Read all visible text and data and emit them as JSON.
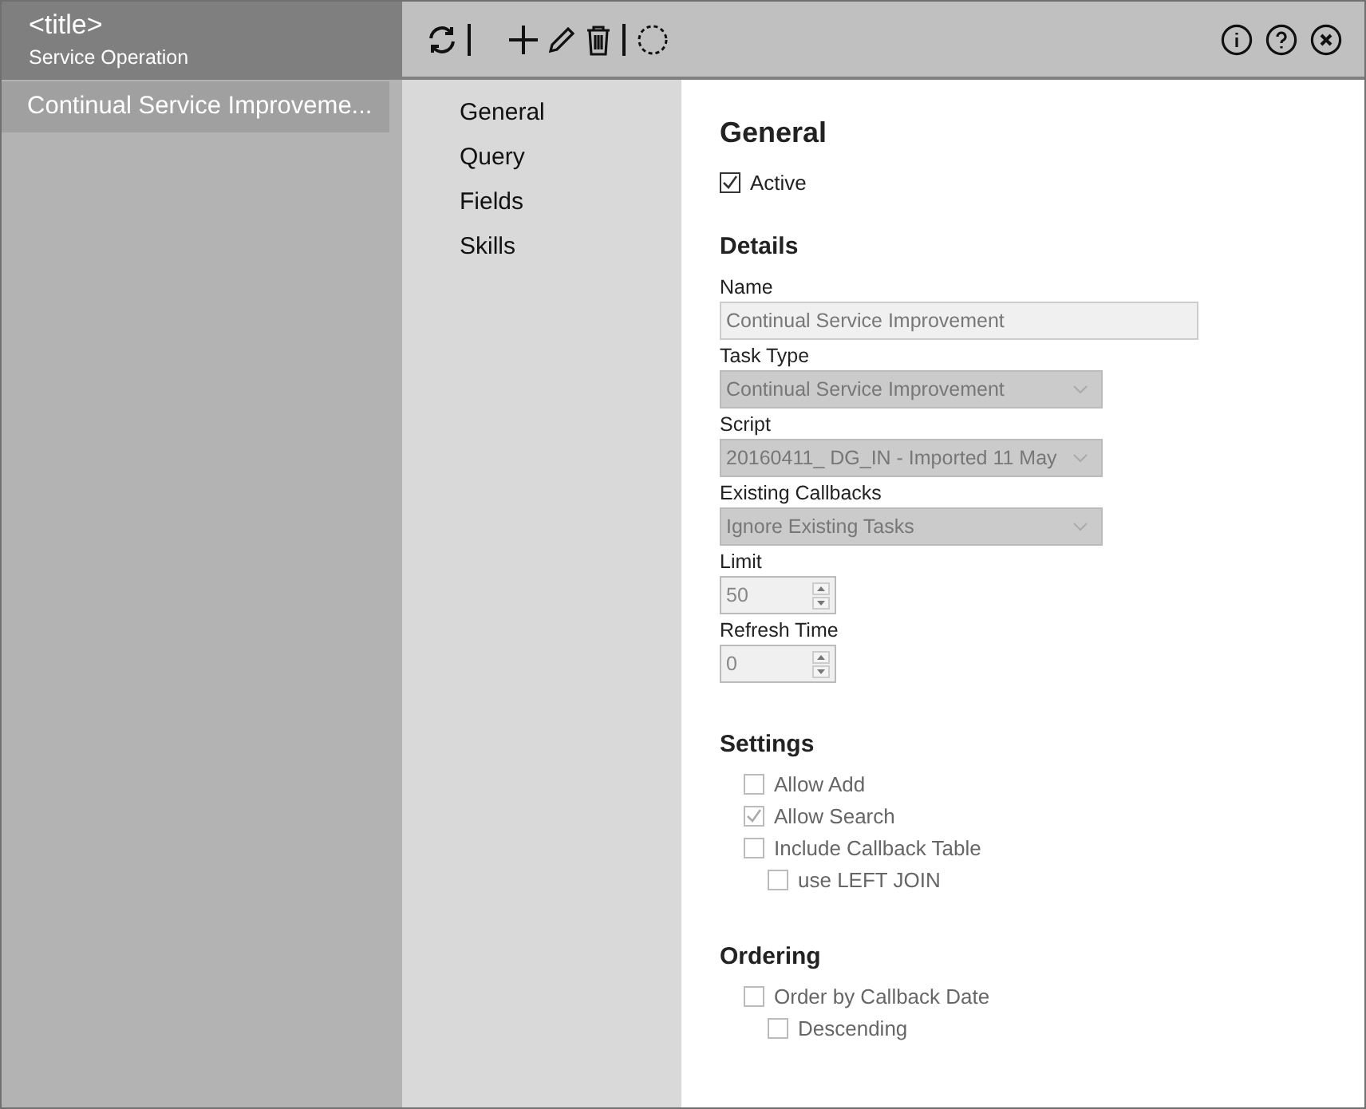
{
  "sidebar": {
    "title": "<title>",
    "subtitle": "Service Operation",
    "items": [
      {
        "label": "Continual Service Improveme...",
        "selected": true
      }
    ]
  },
  "nav": {
    "items": [
      {
        "label": "General",
        "selected": false
      },
      {
        "label": "Query",
        "selected": false
      },
      {
        "label": "Fields",
        "selected": false
      },
      {
        "label": "Skills",
        "selected": false
      }
    ]
  },
  "general": {
    "heading": "General",
    "active": {
      "label": "Active",
      "checked": true,
      "disabled": false
    }
  },
  "details": {
    "heading": "Details",
    "fields": [
      {
        "kind": "text",
        "label": "Name",
        "value": "Continual Service Improvement",
        "disabled": true
      },
      {
        "kind": "select",
        "label": "Task Type",
        "value": "Continual Service Improvement",
        "disabled": true
      },
      {
        "kind": "select",
        "label": "Script",
        "value": "20160411_ DG_IN - Imported 11 May",
        "disabled": true
      },
      {
        "kind": "select",
        "label": "Existing Callbacks",
        "value": "Ignore Existing Tasks",
        "disabled": true
      },
      {
        "kind": "spinner",
        "label": "Limit",
        "value": "50",
        "disabled": true
      },
      {
        "kind": "spinner",
        "label": "Refresh Time",
        "value": "0",
        "disabled": true
      }
    ]
  },
  "settings": {
    "heading": "Settings",
    "options": [
      {
        "label": "Allow Add",
        "checked": false,
        "disabled": true
      },
      {
        "label": "Allow Search",
        "checked": true,
        "disabled": true
      },
      {
        "label": "Include Callback Table",
        "checked": false,
        "disabled": true,
        "children": [
          {
            "label": "use LEFT JOIN",
            "checked": false,
            "disabled": true
          }
        ]
      }
    ]
  },
  "ordering": {
    "heading": "Ordering",
    "options": [
      {
        "label": "Order by Callback Date",
        "checked": false,
        "disabled": true,
        "children": [
          {
            "label": "Descending",
            "checked": false,
            "disabled": true
          }
        ]
      }
    ]
  }
}
